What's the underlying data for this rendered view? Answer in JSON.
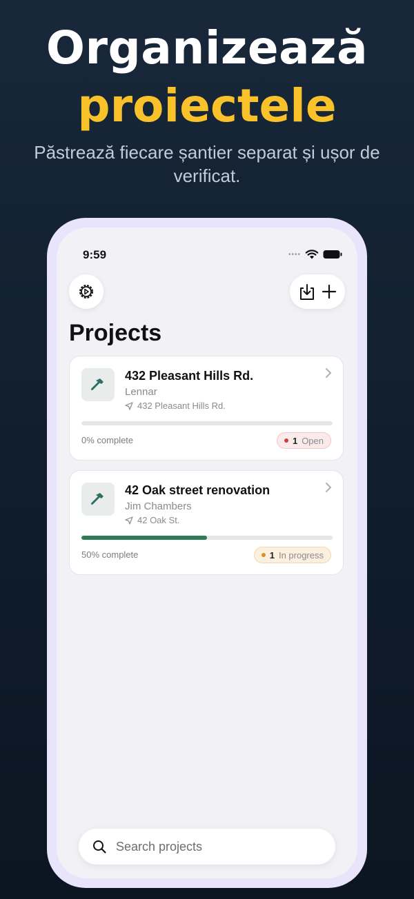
{
  "hero": {
    "title": "Organizează",
    "accent": "proiectele",
    "subtitle": "Păstrează fiecare șantier separat și ușor de verificat."
  },
  "status_bar": {
    "time": "9:59"
  },
  "toolbar": {
    "settings_icon": "gear-icon",
    "import_icon": "tray-download-icon",
    "add_icon": "plus-icon"
  },
  "page": {
    "title": "Projects"
  },
  "projects": [
    {
      "name": "432 Pleasant Hills Rd.",
      "client": "Lennar",
      "address": "432 Pleasant Hills Rd.",
      "progress": 0,
      "progress_label": "0% complete",
      "badge_count": "1",
      "badge_label": "Open",
      "badge_color": "#d03a3a"
    },
    {
      "name": "42 Oak street renovation",
      "client": "Jim Chambers",
      "address": "42 Oak St.",
      "progress": 50,
      "progress_label": "50% complete",
      "badge_count": "1",
      "badge_label": "In progress",
      "badge_color": "#d4902a"
    }
  ],
  "search": {
    "placeholder": "Search projects"
  },
  "colors": {
    "accent": "#f9c22b",
    "progress": "#2d7a55",
    "thumb_icon": "#2d6e66"
  }
}
